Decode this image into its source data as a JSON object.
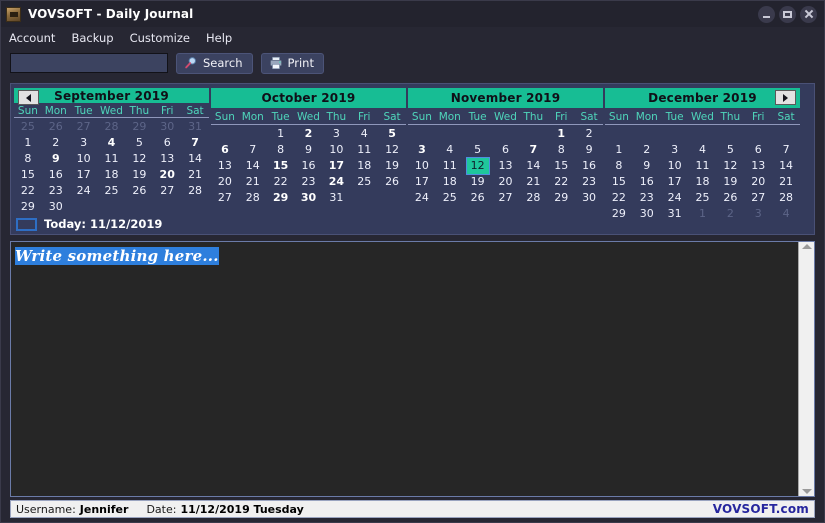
{
  "window": {
    "title": "VOVSOFT - Daily Journal",
    "icon": "journal-book-icon",
    "controls": {
      "minimize": "minimize-icon",
      "maximize": "maximize-icon",
      "close": "close-icon"
    }
  },
  "menu": {
    "items": [
      "Account",
      "Backup",
      "Customize",
      "Help"
    ]
  },
  "toolbar": {
    "search_value": "",
    "search_placeholder": "",
    "search_label": "Search",
    "search_icon": "magnifier-icon",
    "print_label": "Print",
    "print_icon": "printer-icon"
  },
  "calendars": {
    "dow": [
      "Sun",
      "Mon",
      "Tue",
      "Wed",
      "Thu",
      "Fri",
      "Sat"
    ],
    "prev_arrow": "triangle-left-icon",
    "next_arrow": "triangle-right-icon",
    "today_legend_label": "Today: 11/12/2019",
    "months": [
      {
        "title": "September 2019",
        "has_prev": true,
        "has_next": false,
        "cells": [
          {
            "d": "25",
            "s": "muted"
          },
          {
            "d": "26",
            "s": "muted"
          },
          {
            "d": "27",
            "s": "muted"
          },
          {
            "d": "28",
            "s": "muted"
          },
          {
            "d": "29",
            "s": "muted"
          },
          {
            "d": "30",
            "s": "muted"
          },
          {
            "d": "31",
            "s": "muted"
          },
          {
            "d": "1",
            "s": ""
          },
          {
            "d": "2",
            "s": ""
          },
          {
            "d": "3",
            "s": ""
          },
          {
            "d": "4",
            "s": "bold"
          },
          {
            "d": "5",
            "s": ""
          },
          {
            "d": "6",
            "s": ""
          },
          {
            "d": "7",
            "s": "bold"
          },
          {
            "d": "8",
            "s": ""
          },
          {
            "d": "9",
            "s": "bold"
          },
          {
            "d": "10",
            "s": ""
          },
          {
            "d": "11",
            "s": ""
          },
          {
            "d": "12",
            "s": ""
          },
          {
            "d": "13",
            "s": ""
          },
          {
            "d": "14",
            "s": ""
          },
          {
            "d": "15",
            "s": ""
          },
          {
            "d": "16",
            "s": ""
          },
          {
            "d": "17",
            "s": ""
          },
          {
            "d": "18",
            "s": ""
          },
          {
            "d": "19",
            "s": ""
          },
          {
            "d": "20",
            "s": "bold"
          },
          {
            "d": "21",
            "s": ""
          },
          {
            "d": "22",
            "s": ""
          },
          {
            "d": "23",
            "s": ""
          },
          {
            "d": "24",
            "s": ""
          },
          {
            "d": "25",
            "s": ""
          },
          {
            "d": "26",
            "s": ""
          },
          {
            "d": "27",
            "s": ""
          },
          {
            "d": "28",
            "s": ""
          },
          {
            "d": "29",
            "s": ""
          },
          {
            "d": "30",
            "s": ""
          },
          {
            "d": "",
            "s": ""
          },
          {
            "d": "",
            "s": ""
          },
          {
            "d": "",
            "s": ""
          },
          {
            "d": "",
            "s": ""
          },
          {
            "d": "",
            "s": ""
          }
        ]
      },
      {
        "title": "October 2019",
        "has_prev": false,
        "has_next": false,
        "cells": [
          {
            "d": "",
            "s": ""
          },
          {
            "d": "",
            "s": ""
          },
          {
            "d": "1",
            "s": ""
          },
          {
            "d": "2",
            "s": "bold"
          },
          {
            "d": "3",
            "s": ""
          },
          {
            "d": "4",
            "s": ""
          },
          {
            "d": "5",
            "s": "bold"
          },
          {
            "d": "6",
            "s": "bold"
          },
          {
            "d": "7",
            "s": ""
          },
          {
            "d": "8",
            "s": ""
          },
          {
            "d": "9",
            "s": ""
          },
          {
            "d": "10",
            "s": ""
          },
          {
            "d": "11",
            "s": ""
          },
          {
            "d": "12",
            "s": ""
          },
          {
            "d": "13",
            "s": ""
          },
          {
            "d": "14",
            "s": ""
          },
          {
            "d": "15",
            "s": "bold"
          },
          {
            "d": "16",
            "s": ""
          },
          {
            "d": "17",
            "s": "bold"
          },
          {
            "d": "18",
            "s": ""
          },
          {
            "d": "19",
            "s": ""
          },
          {
            "d": "20",
            "s": ""
          },
          {
            "d": "21",
            "s": ""
          },
          {
            "d": "22",
            "s": ""
          },
          {
            "d": "23",
            "s": ""
          },
          {
            "d": "24",
            "s": "bold"
          },
          {
            "d": "25",
            "s": ""
          },
          {
            "d": "26",
            "s": ""
          },
          {
            "d": "27",
            "s": ""
          },
          {
            "d": "28",
            "s": ""
          },
          {
            "d": "29",
            "s": "bold"
          },
          {
            "d": "30",
            "s": "bold"
          },
          {
            "d": "31",
            "s": ""
          },
          {
            "d": "",
            "s": ""
          },
          {
            "d": "",
            "s": ""
          },
          {
            "d": "",
            "s": ""
          },
          {
            "d": "",
            "s": ""
          },
          {
            "d": "",
            "s": ""
          },
          {
            "d": "",
            "s": ""
          },
          {
            "d": "",
            "s": ""
          },
          {
            "d": "",
            "s": ""
          },
          {
            "d": "",
            "s": ""
          }
        ]
      },
      {
        "title": "November 2019",
        "has_prev": false,
        "has_next": false,
        "cells": [
          {
            "d": "",
            "s": ""
          },
          {
            "d": "",
            "s": ""
          },
          {
            "d": "",
            "s": ""
          },
          {
            "d": "",
            "s": ""
          },
          {
            "d": "",
            "s": ""
          },
          {
            "d": "1",
            "s": "bold"
          },
          {
            "d": "2",
            "s": ""
          },
          {
            "d": "3",
            "s": "bold"
          },
          {
            "d": "4",
            "s": ""
          },
          {
            "d": "5",
            "s": ""
          },
          {
            "d": "6",
            "s": ""
          },
          {
            "d": "7",
            "s": "bold"
          },
          {
            "d": "8",
            "s": ""
          },
          {
            "d": "9",
            "s": ""
          },
          {
            "d": "10",
            "s": ""
          },
          {
            "d": "11",
            "s": ""
          },
          {
            "d": "12",
            "s": "sel"
          },
          {
            "d": "13",
            "s": ""
          },
          {
            "d": "14",
            "s": ""
          },
          {
            "d": "15",
            "s": ""
          },
          {
            "d": "16",
            "s": ""
          },
          {
            "d": "17",
            "s": ""
          },
          {
            "d": "18",
            "s": ""
          },
          {
            "d": "19",
            "s": ""
          },
          {
            "d": "20",
            "s": ""
          },
          {
            "d": "21",
            "s": ""
          },
          {
            "d": "22",
            "s": ""
          },
          {
            "d": "23",
            "s": ""
          },
          {
            "d": "24",
            "s": ""
          },
          {
            "d": "25",
            "s": ""
          },
          {
            "d": "26",
            "s": ""
          },
          {
            "d": "27",
            "s": ""
          },
          {
            "d": "28",
            "s": ""
          },
          {
            "d": "29",
            "s": ""
          },
          {
            "d": "30",
            "s": ""
          },
          {
            "d": "",
            "s": ""
          },
          {
            "d": "",
            "s": ""
          },
          {
            "d": "",
            "s": ""
          },
          {
            "d": "",
            "s": ""
          },
          {
            "d": "",
            "s": ""
          },
          {
            "d": "",
            "s": ""
          },
          {
            "d": "",
            "s": ""
          }
        ]
      },
      {
        "title": "December 2019",
        "has_prev": false,
        "has_next": true,
        "cells": [
          {
            "d": "",
            "s": ""
          },
          {
            "d": "",
            "s": ""
          },
          {
            "d": "",
            "s": ""
          },
          {
            "d": "",
            "s": ""
          },
          {
            "d": "",
            "s": ""
          },
          {
            "d": "",
            "s": ""
          },
          {
            "d": "",
            "s": ""
          },
          {
            "d": "1",
            "s": ""
          },
          {
            "d": "2",
            "s": ""
          },
          {
            "d": "3",
            "s": ""
          },
          {
            "d": "4",
            "s": ""
          },
          {
            "d": "5",
            "s": ""
          },
          {
            "d": "6",
            "s": ""
          },
          {
            "d": "7",
            "s": ""
          },
          {
            "d": "8",
            "s": ""
          },
          {
            "d": "9",
            "s": ""
          },
          {
            "d": "10",
            "s": ""
          },
          {
            "d": "11",
            "s": ""
          },
          {
            "d": "12",
            "s": ""
          },
          {
            "d": "13",
            "s": ""
          },
          {
            "d": "14",
            "s": ""
          },
          {
            "d": "15",
            "s": ""
          },
          {
            "d": "16",
            "s": ""
          },
          {
            "d": "17",
            "s": ""
          },
          {
            "d": "18",
            "s": ""
          },
          {
            "d": "19",
            "s": ""
          },
          {
            "d": "20",
            "s": ""
          },
          {
            "d": "21",
            "s": ""
          },
          {
            "d": "22",
            "s": ""
          },
          {
            "d": "23",
            "s": ""
          },
          {
            "d": "24",
            "s": ""
          },
          {
            "d": "25",
            "s": ""
          },
          {
            "d": "26",
            "s": ""
          },
          {
            "d": "27",
            "s": ""
          },
          {
            "d": "28",
            "s": ""
          },
          {
            "d": "29",
            "s": ""
          },
          {
            "d": "30",
            "s": ""
          },
          {
            "d": "31",
            "s": ""
          },
          {
            "d": "1",
            "s": "muted"
          },
          {
            "d": "2",
            "s": "muted"
          },
          {
            "d": "3",
            "s": "muted"
          },
          {
            "d": "4",
            "s": "muted"
          }
        ]
      }
    ]
  },
  "editor": {
    "text": "Write something here...",
    "selected": true,
    "scroll_up_icon": "chevron-up-icon",
    "scroll_down_icon": "chevron-down-icon"
  },
  "status": {
    "username_label": "Username:",
    "username_value": "Jennifer",
    "date_label": "Date:",
    "date_value": "11/12/2019 Tuesday",
    "brand": "VOVSOFT.com"
  },
  "colors": {
    "window_bg": "#272733",
    "panel_bg": "#343b5c",
    "accent_teal": "#17bd94",
    "selection_blue": "#2e7fdd",
    "editor_bg": "#262626",
    "brand_blue": "#26269e"
  }
}
